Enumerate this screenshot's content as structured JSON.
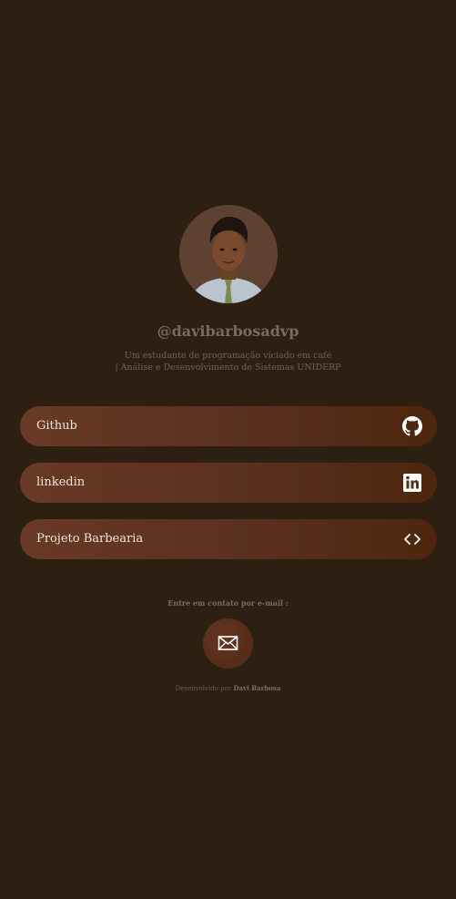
{
  "profile": {
    "handle": "@davibarbosadvp",
    "bio_line1": "Um estudante de programação viciado em café",
    "bio_line2": "| Análise e Desenvolvimento de Sistemas UNIDERP"
  },
  "links": [
    {
      "label": "Github",
      "icon": "github-icon"
    },
    {
      "label": "linkedin",
      "icon": "linkedin-icon"
    },
    {
      "label": "Projeto Barbearia",
      "icon": "code-icon"
    }
  ],
  "contact": {
    "label": "Entre em contato por e-mail :",
    "icon": "envelope-icon"
  },
  "footer": {
    "prefix": "Desenvolvido por",
    "author": "Davi Barbosa"
  },
  "colors": {
    "background": "#2e1f13",
    "button_gradient_start": "#693a25",
    "button_gradient_end": "#4d260e",
    "button_text": "#efe4dc"
  }
}
